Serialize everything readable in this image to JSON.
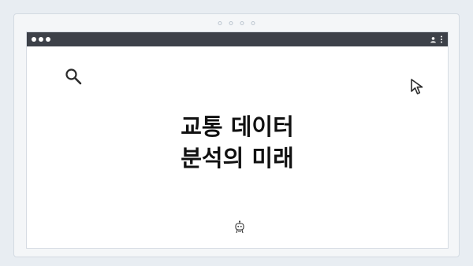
{
  "frame": {
    "indicator_count": 4
  },
  "window": {
    "controls": [
      "close-dot",
      "minimize-dot",
      "maximize-dot"
    ],
    "actions": [
      "user-icon",
      "more-vertical-icon"
    ]
  },
  "content": {
    "title_line1": "교통 데이터",
    "title_line2": "분석의 미래",
    "icons": [
      "search-icon",
      "cursor-icon",
      "bot-icon"
    ]
  },
  "colors": {
    "background": "#e8edf2",
    "titlebar": "#3d4149",
    "window": "#ffffff",
    "text": "#111111"
  }
}
